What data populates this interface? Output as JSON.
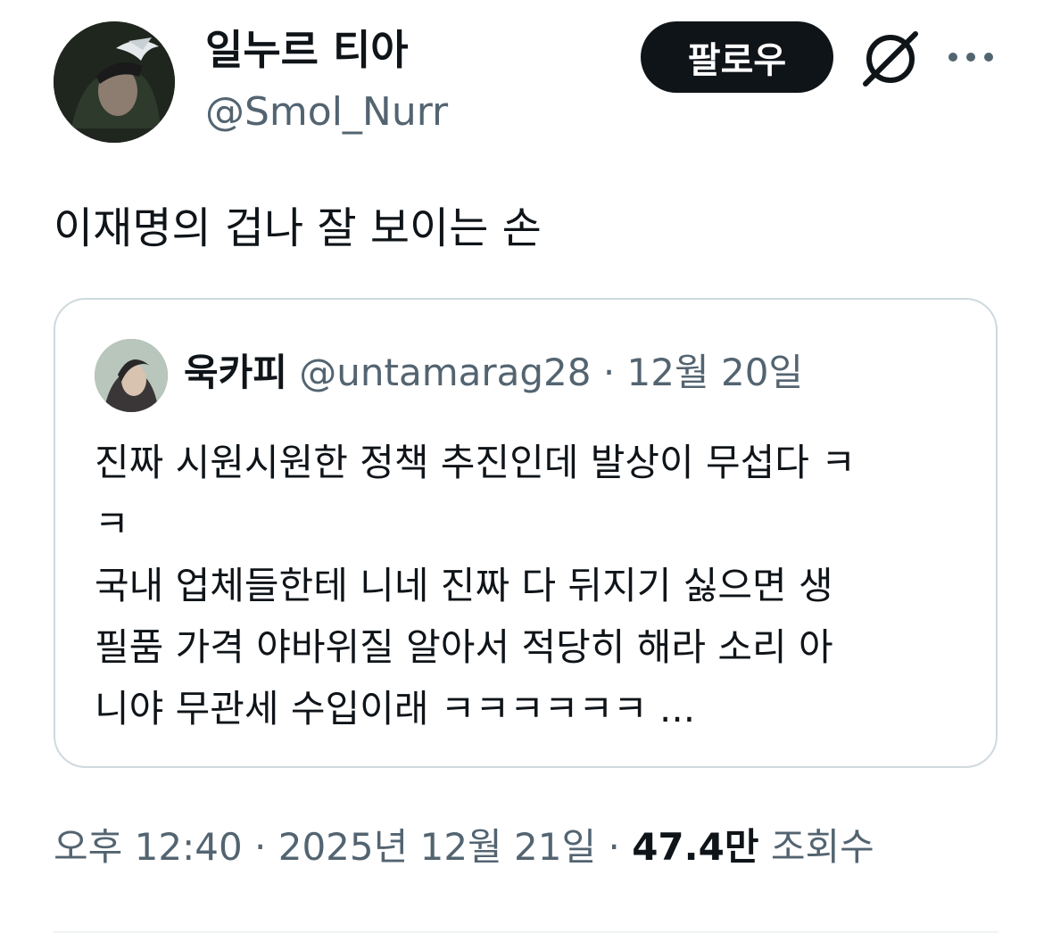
{
  "author": {
    "display_name": "일누르 티아",
    "handle": "@Smol_Nurr"
  },
  "header": {
    "follow_label": "팔로우",
    "icons": [
      "grok-icon",
      "more-icon"
    ]
  },
  "tweet": {
    "text": "이재명의 겁나 잘 보이는 손"
  },
  "quote": {
    "display_name": "욱카피",
    "handle": "@untamarag28",
    "separator": " · ",
    "date": "12월 20일",
    "lines": [
      "진짜 시원시원한 정책 추진인데 발상이 무섭다 ㅋ",
      "ㅋ",
      "국내 업체들한테 니네 진짜 다 뒤지기 싫으면 생",
      "필품 가격 야바위질 알아서 적당히 해라 소리 아",
      "니야 무관세 수입이래 ㅋㅋㅋㅋㅋㅋ ..."
    ]
  },
  "meta": {
    "time": "오후 12:40",
    "separator": " · ",
    "date": "2025년 12월 21일",
    "views_count": "47.4만",
    "views_label": "조회수"
  },
  "colors": {
    "text_primary": "#0f1419",
    "text_secondary": "#536471",
    "border": "#cfd9de",
    "button_bg": "#0f1419"
  }
}
